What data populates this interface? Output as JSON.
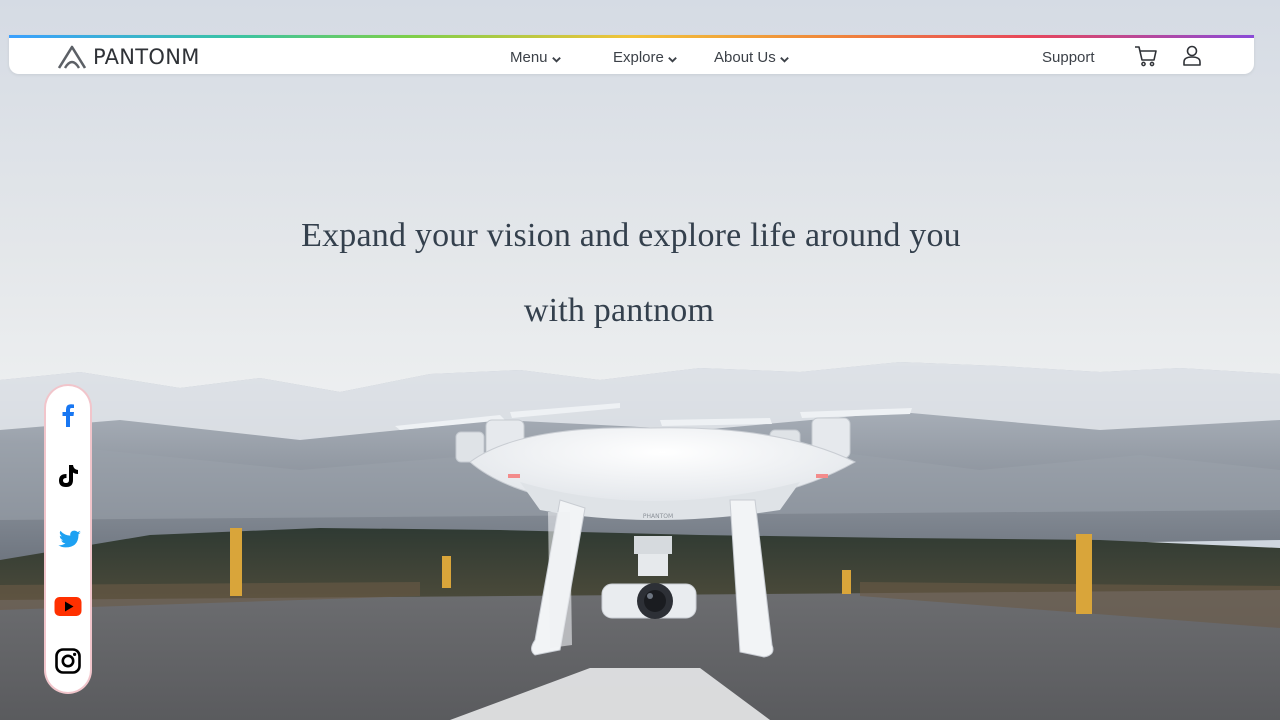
{
  "brand": {
    "name": "PANTONM"
  },
  "nav": {
    "menu": "Menu",
    "explore": "Explore",
    "about": "About Us",
    "support": "Support",
    "cart_icon": "shopping-cart-icon",
    "user_icon": "user-icon"
  },
  "hero": {
    "line1": "Expand your vision and explore life around you",
    "line2": "with pantnom",
    "drone_label": "PHANTOM"
  },
  "social": [
    {
      "name": "facebook",
      "icon": "facebook-icon",
      "color": "#1877f2"
    },
    {
      "name": "tiktok",
      "icon": "tiktok-icon",
      "color": "#000000"
    },
    {
      "name": "twitter",
      "icon": "twitter-icon",
      "color": "#1da1f2"
    },
    {
      "name": "youtube",
      "icon": "youtube-icon",
      "color": "#ff3000"
    },
    {
      "name": "instagram",
      "icon": "instagram-icon",
      "color": "#000000"
    }
  ],
  "colors": {
    "headline": "#34404d",
    "nav_text": "#3c4148",
    "rail_border": "#f1c5cb"
  }
}
